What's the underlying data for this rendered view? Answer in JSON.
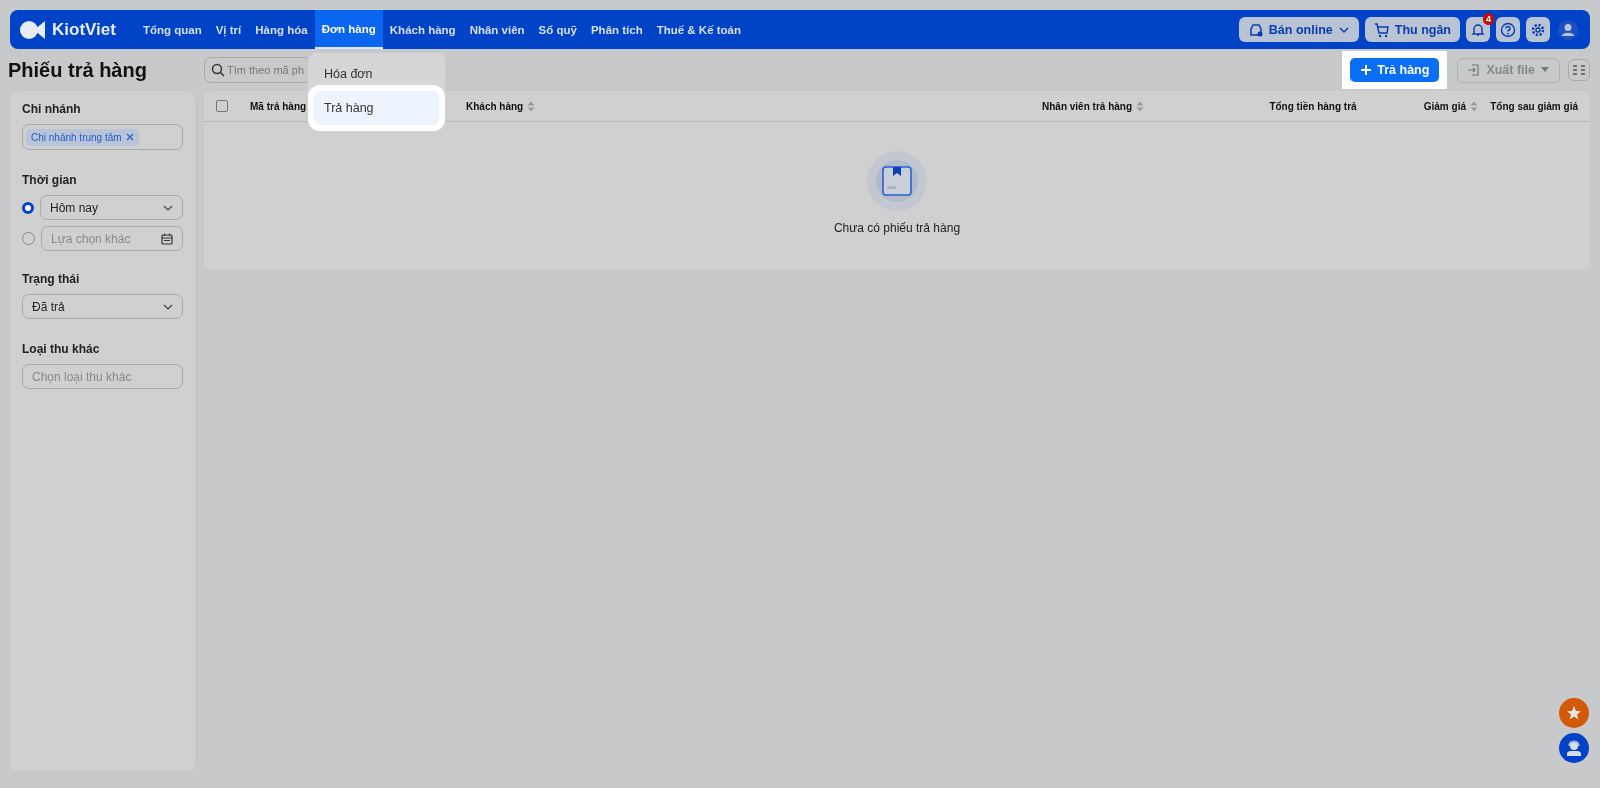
{
  "nav": {
    "logo": "KiotViet",
    "items": [
      {
        "label": "Tổng quan",
        "selected": false
      },
      {
        "label": "Vị trí",
        "selected": false
      },
      {
        "label": "Hàng hóa",
        "selected": false
      },
      {
        "label": "Đơn hàng",
        "selected": true
      },
      {
        "label": "Khách hàng",
        "selected": false
      },
      {
        "label": "Nhân viên",
        "selected": false
      },
      {
        "label": "Sổ quỹ",
        "selected": false
      },
      {
        "label": "Phân tích",
        "selected": false
      },
      {
        "label": "Thuế & Kế toán",
        "selected": false
      }
    ],
    "online_button": "Bán online",
    "cashier_button": "Thu ngân",
    "notification_count": "4"
  },
  "dropdown": [
    {
      "label": "Hóa đơn",
      "selected": false
    },
    {
      "label": "Trả hàng",
      "selected": true
    }
  ],
  "page_title": "Phiếu trả hàng",
  "search": {
    "placeholder": "Tìm theo mã ph"
  },
  "add_button": "Trả hàng",
  "export_button": "Xuất file",
  "filters": {
    "branch": {
      "label": "Chi nhánh",
      "tags": [
        "Chi nhánh trung tâm"
      ]
    },
    "time": {
      "label": "Thời gian",
      "options": [
        {
          "kind": "select",
          "value": "Hôm nay",
          "selected": true
        },
        {
          "kind": "date",
          "placeholder": "Lựa chọn khác",
          "selected": false
        }
      ]
    },
    "status": {
      "label": "Trạng thái",
      "value": "Đã trả"
    },
    "other_income": {
      "label": "Loại thu khác",
      "placeholder": "Chọn loại thu khác"
    }
  },
  "table": {
    "select_all_checked": false,
    "columns": [
      {
        "label": "Mã trả hàng",
        "sortable": false
      },
      {
        "label": "Khách hàng",
        "sortable": true
      },
      {
        "label": "Nhân viên trả hàng",
        "sortable": true
      },
      {
        "label": "Tổng tiền hàng trả",
        "sortable": false
      },
      {
        "label": "Giảm giá",
        "sortable": true
      },
      {
        "label": "Tổng sau giảm giá",
        "sortable": false
      }
    ],
    "empty_message": "Chưa có phiếu trả hàng"
  }
}
